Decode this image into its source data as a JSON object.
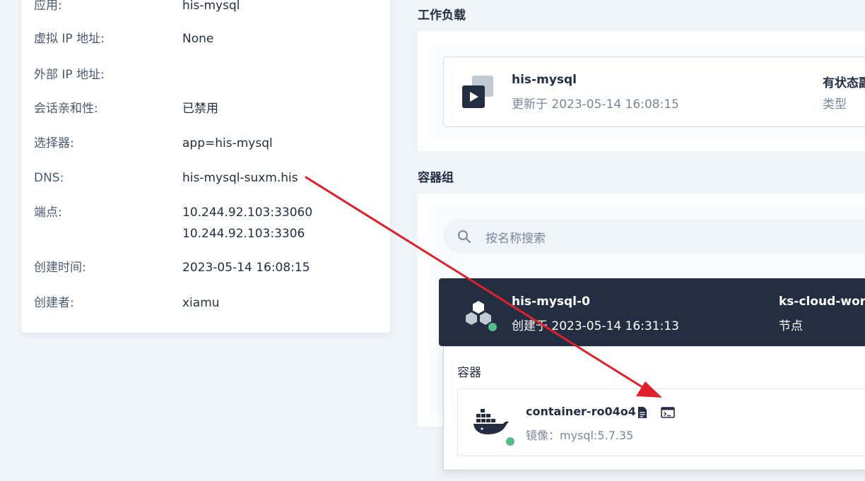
{
  "details": {
    "rows": [
      {
        "label": "应用:",
        "value": "his-mysql"
      },
      {
        "label": "虚拟 IP 地址:",
        "value": "None"
      },
      {
        "label": "外部 IP 地址:",
        "value": ""
      },
      {
        "label": "会话亲和性:",
        "value": "已禁用"
      },
      {
        "label": "选择器:",
        "value": "app=his-mysql"
      },
      {
        "label": "DNS:",
        "value": "his-mysql-suxm.his"
      },
      {
        "label": "端点:",
        "value": "10.244.92.103:33060",
        "value2": "10.244.92.103:3306"
      },
      {
        "label": "创建时间:",
        "value": "2023-05-14 16:08:15"
      },
      {
        "label": "创建者:",
        "value": "xiamu"
      }
    ]
  },
  "workload": {
    "section_title": "工作负载",
    "name": "his-mysql",
    "updated": "更新于 2023-05-14 16:08:15",
    "type_value": "有状态副本集",
    "type_label": "类型"
  },
  "pods": {
    "section_title": "容器组",
    "search_placeholder": "按名称搜索",
    "pod": {
      "name": "his-mysql-0",
      "created": "创建于 2023-05-14 16:31:13",
      "node_value": "ks-cloud-worker",
      "node_label": "节点"
    },
    "containers_title": "容器",
    "container": {
      "name": "container-ro04o4",
      "image": "镜像：mysql:5.7.35"
    }
  },
  "colors": {
    "accent_dark": "#242e42",
    "status_green": "#55bc8a",
    "annotation_red": "#e0202a"
  }
}
